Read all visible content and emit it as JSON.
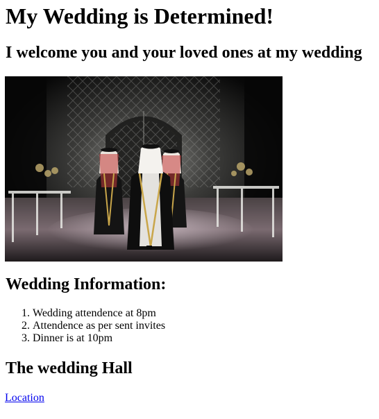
{
  "page": {
    "title": "My Wedding is Determined!",
    "subtitle": "I welcome you and your loved ones at my wedding"
  },
  "photo": {
    "alt": "Groom and guests walking down a wedding hall aisle"
  },
  "info": {
    "heading": "Wedding Information:",
    "items": [
      "Wedding attendence at 8pm",
      "Attendence as per sent invites",
      "Dinner is at 10pm"
    ]
  },
  "hall": {
    "heading": "The wedding Hall",
    "link_label": "Location"
  },
  "colors": {
    "link": "#0000ee",
    "text": "#000000",
    "background": "#ffffff"
  }
}
